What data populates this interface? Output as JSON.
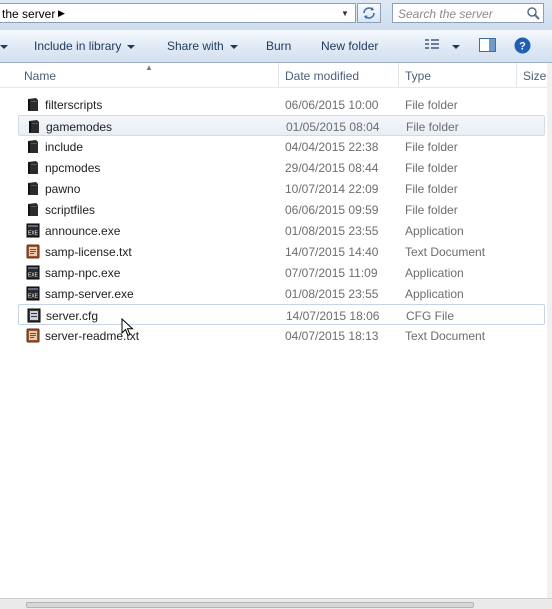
{
  "address": {
    "breadcrumb": "the server",
    "search_placeholder": "Search the server"
  },
  "toolbar": {
    "include_in_library": "Include in library",
    "share_with": "Share with",
    "burn": "Burn",
    "new_folder": "New folder"
  },
  "columns": {
    "name": "Name",
    "date_modified": "Date modified",
    "type": "Type",
    "size": "Size"
  },
  "files": [
    {
      "name": "filterscripts",
      "date": "06/06/2015 10:00",
      "type": "File folder",
      "icon": "folder-icon"
    },
    {
      "name": "gamemodes",
      "date": "01/05/2015 08:04",
      "type": "File folder",
      "icon": "folder-icon"
    },
    {
      "name": "include",
      "date": "04/04/2015 22:38",
      "type": "File folder",
      "icon": "folder-icon"
    },
    {
      "name": "npcmodes",
      "date": "29/04/2015 08:44",
      "type": "File folder",
      "icon": "folder-icon"
    },
    {
      "name": "pawno",
      "date": "10/07/2014 22:09",
      "type": "File folder",
      "icon": "folder-icon"
    },
    {
      "name": "scriptfiles",
      "date": "06/06/2015 09:59",
      "type": "File folder",
      "icon": "folder-icon"
    },
    {
      "name": "announce.exe",
      "date": "01/08/2015 23:55",
      "type": "Application",
      "icon": "exe-icon"
    },
    {
      "name": "samp-license.txt",
      "date": "14/07/2015 14:40",
      "type": "Text Document",
      "icon": "text-file-icon"
    },
    {
      "name": "samp-npc.exe",
      "date": "07/07/2015 11:09",
      "type": "Application",
      "icon": "exe-icon"
    },
    {
      "name": "samp-server.exe",
      "date": "01/08/2015 23:55",
      "type": "Application",
      "icon": "exe-icon"
    },
    {
      "name": "server.cfg",
      "date": "14/07/2015 18:06",
      "type": "CFG File",
      "icon": "cfg-file-icon"
    },
    {
      "name": "server-readme.txt",
      "date": "04/07/2015 18:13",
      "type": "Text Document",
      "icon": "text-file-icon"
    }
  ]
}
